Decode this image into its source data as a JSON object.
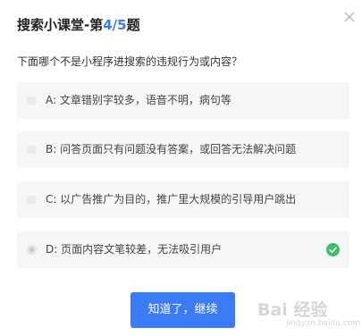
{
  "header": {
    "title_prefix": "搜索小课堂-第",
    "current": "4",
    "separator": "/",
    "total": "5",
    "title_suffix": "题",
    "close_icon": "close-icon"
  },
  "question": {
    "text": "下面哪个不是小程序进搜索的违规行为或内容？"
  },
  "options": [
    {
      "label": "A: 文章错别字较多，语音不明，病句等",
      "selected": false
    },
    {
      "label": "B: 问答页面只有问题没有答案，或回答无法解决问题",
      "selected": false
    },
    {
      "label": "C: 以广告推广为目的，推广里大规模的引导用户跳出",
      "selected": false
    },
    {
      "label": "D: 页面内容文笔较差，无法吸引用户",
      "selected": true,
      "correct": true
    }
  ],
  "footer": {
    "confirm_label": "知道了，继续"
  },
  "watermark": {
    "brand": "Bai 经验",
    "url": "jingyan.baidu.com"
  },
  "colors": {
    "accent": "#3b7bf6",
    "success": "#3bbf6a",
    "option_bg": "#f5f6f8"
  }
}
